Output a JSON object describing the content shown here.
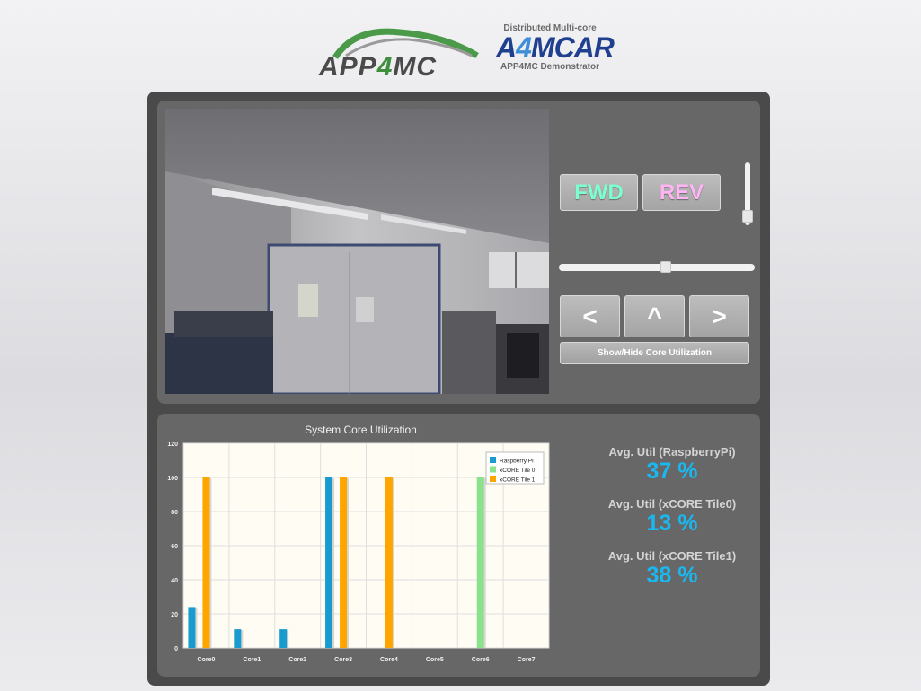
{
  "header": {
    "logo1": {
      "part1": "APP",
      "part2": "4",
      "part3": "MC"
    },
    "logo2": {
      "top": "Distributed Multi-core",
      "part1": "A",
      "part2": "4",
      "part3": "MCAR",
      "bottom": "APP4MC Demonstrator"
    }
  },
  "controls": {
    "fwd_label": "FWD",
    "rev_label": "REV",
    "left_label": "<",
    "up_label": "^",
    "right_label": ">",
    "toggle_label": "Show/Hide Core Utilization",
    "speed_slider_level": 0.1,
    "steering_slider_level": 0.55
  },
  "chart": {
    "title": "System Core Utilization"
  },
  "chart_data": {
    "type": "bar",
    "title": "System Core Utilization",
    "categories": [
      "Core0",
      "Core1",
      "Core2",
      "Core3",
      "Core4",
      "Core5",
      "Core6",
      "Core7"
    ],
    "ylim": [
      0,
      120
    ],
    "yticks": [
      0,
      20,
      40,
      60,
      80,
      100,
      120
    ],
    "grid": true,
    "legend_position": "top-right",
    "series": [
      {
        "name": "Raspberry Pi",
        "color": "#1a9bd0",
        "values": [
          24,
          11,
          11,
          100,
          0,
          0,
          0,
          0
        ]
      },
      {
        "name": "xCORE Tile 0",
        "color": "#8ce28c",
        "values": [
          0,
          0,
          0,
          0,
          0,
          0,
          100,
          0
        ]
      },
      {
        "name": "xCORE Tile 1",
        "color": "#ffa500",
        "values": [
          100,
          0,
          0,
          100,
          100,
          0,
          0,
          0
        ]
      }
    ]
  },
  "stats": [
    {
      "label": "Avg. Util (RaspberryPi)",
      "value": "37 %"
    },
    {
      "label": "Avg. Util (xCORE Tile0)",
      "value": "13 %"
    },
    {
      "label": "Avg. Util (xCORE Tile1)",
      "value": "38 %"
    }
  ],
  "colors": {
    "fwd": "#7dffcf",
    "rev": "#ffb4f4",
    "stat_value": "#19b8f0"
  }
}
